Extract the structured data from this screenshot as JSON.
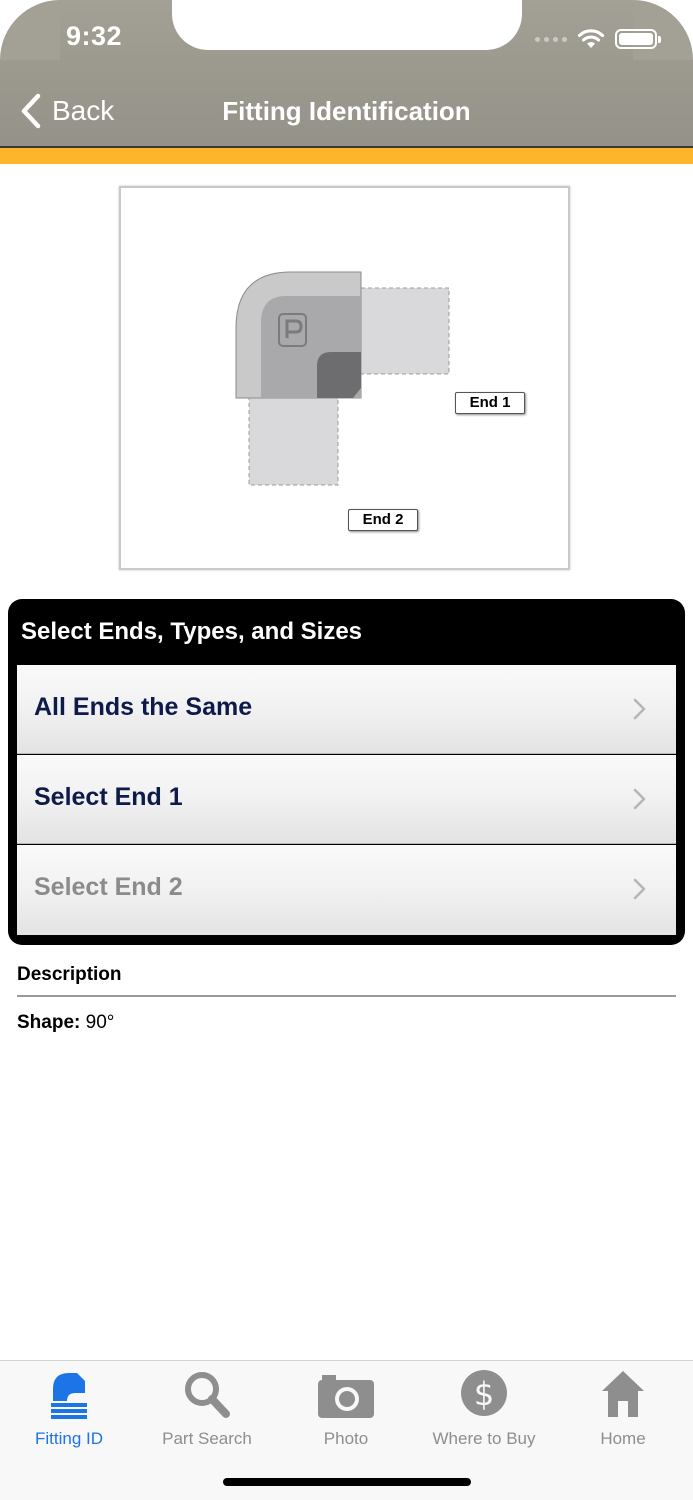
{
  "status_bar": {
    "time": "9:32"
  },
  "nav": {
    "back_label": "Back",
    "title": "Fitting Identification"
  },
  "diagram": {
    "end1_label": "End 1",
    "end2_label": "End 2"
  },
  "panel": {
    "title": "Select Ends, Types, and Sizes",
    "rows": [
      {
        "label": "All Ends the Same",
        "enabled": true
      },
      {
        "label": "Select End 1",
        "enabled": true
      },
      {
        "label": "Select End 2",
        "enabled": false
      }
    ]
  },
  "description": {
    "title": "Description",
    "shape_label": "Shape:",
    "shape_value": "90°"
  },
  "tabs": [
    {
      "label": "Fitting ID",
      "icon": "fitting-icon",
      "active": true
    },
    {
      "label": "Part Search",
      "icon": "magnifier-icon",
      "active": false
    },
    {
      "label": "Photo",
      "icon": "camera-icon",
      "active": false
    },
    {
      "label": "Where to Buy",
      "icon": "dollar-icon",
      "active": false
    },
    {
      "label": "Home",
      "icon": "home-icon",
      "active": false
    }
  ],
  "colors": {
    "accent": "#fdb52a",
    "nav": "#9c9990",
    "active_tab": "#1d74e6",
    "row_text": "#0d1a4a"
  }
}
